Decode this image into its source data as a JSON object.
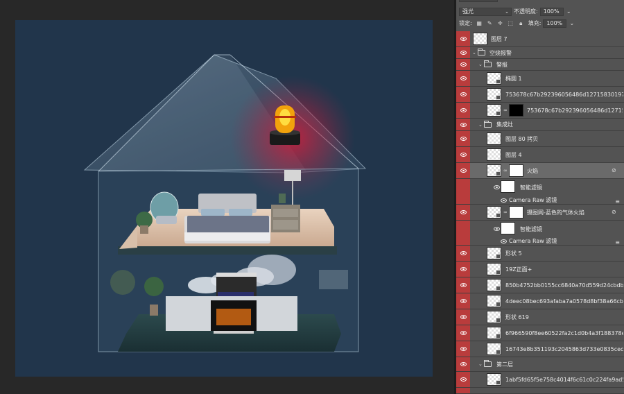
{
  "panel": {
    "blend_mode": "强光",
    "opacity_label": "不透明度:",
    "opacity_value": "100%",
    "lock_label": "锁定:",
    "fill_label": "填充:",
    "fill_value": "100%"
  },
  "layers": [
    {
      "name": "图层 7",
      "type": "layer",
      "visible_marked": true
    },
    {
      "name": "空烧报警",
      "type": "group",
      "visible_marked": true
    },
    {
      "name": "警报",
      "type": "group",
      "visible_marked": true
    },
    {
      "name": "椭圆 1",
      "type": "shape",
      "visible_marked": true
    },
    {
      "name": "753678c67b292396056486d1271583019787b4...",
      "type": "smart",
      "visible_marked": true
    },
    {
      "name": "753678c67b292396056486d12715830...",
      "type": "masked",
      "visible_marked": true
    },
    {
      "name": "集成灶",
      "type": "group",
      "visible_marked": true
    },
    {
      "name": "图层 80 拷贝",
      "type": "layer",
      "visible_marked": true
    },
    {
      "name": "图层 4",
      "type": "layer",
      "visible_marked": true
    },
    {
      "name": "火焰",
      "type": "smart-masked",
      "visible_marked": true,
      "selected": true
    },
    {
      "name": "智能滤镜",
      "type": "filter-group"
    },
    {
      "name": "Camera Raw 滤镜",
      "type": "filter"
    },
    {
      "name": "摄图网-蓝色的气体火焰",
      "type": "smart-masked",
      "visible_marked": true
    },
    {
      "name": "智能滤镜",
      "type": "filter-group"
    },
    {
      "name": "Camera Raw 滤镜",
      "type": "filter"
    },
    {
      "name": "形状 5",
      "type": "shape",
      "visible_marked": true
    },
    {
      "name": "19Z正面+",
      "type": "smart",
      "visible_marked": true
    },
    {
      "name": "850b4752bb0155cc6840a70d559d24cbdb3a16b...",
      "type": "smart",
      "visible_marked": true
    },
    {
      "name": "4deec08bec693afaba7a0578d8bf38a66cbb07b9...",
      "type": "smart",
      "visible_marked": true
    },
    {
      "name": "形状 619",
      "type": "shape",
      "visible_marked": true
    },
    {
      "name": "6f966590f8ee60522fa2c1d0b4a3f188378e95b2...",
      "type": "smart",
      "visible_marked": true
    },
    {
      "name": "16743e8b351193c2045863d733e0835cec363f1...",
      "type": "smart",
      "visible_marked": true
    },
    {
      "name": "第二层",
      "type": "group",
      "visible_marked": true
    },
    {
      "name": "1abf5fd65f5e758c4014f6c61c0c224fa9ad50...",
      "type": "smart",
      "visible_marked": true
    }
  ],
  "colors": {
    "canvas_bg": "#21354b",
    "workspace_bg": "#282828",
    "panel_bg": "#535353",
    "eye_marker": "#b93c3c",
    "alarm_glow": "#c8283c"
  }
}
